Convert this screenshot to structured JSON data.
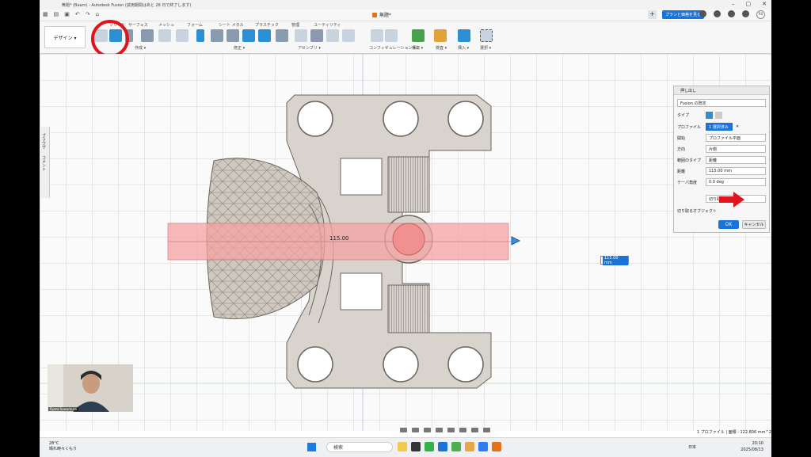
{
  "window": {
    "title": "無題* (Baam) - Autodesk Fusion (試用期間はあと 28 日で終了します)",
    "doc_tab": "無題*",
    "buy_button": "プランと価格を見る",
    "user_initials": "RS"
  },
  "toolbar": {
    "design_label": "デザイン ▾",
    "groups": {
      "solid": "ソリッド",
      "surface": "サーフェス",
      "mesh": "メッシュ",
      "form": "フォーム",
      "sheet_metal": "シート メタル",
      "plastic": "プラスチック",
      "manage": "管理",
      "utility": "ユーティリティ"
    },
    "bottom_labels": {
      "create": "作成 ▾",
      "modify": "修正 ▾",
      "assemble": "アセンブリ ▾",
      "configure": "コンフィギュレーション ▾",
      "construct": "構築 ▾",
      "inspect": "検査 ▾",
      "insert": "挿入 ▾",
      "select": "選択 ▾"
    }
  },
  "left_panel": {
    "browser": "ブラウザ",
    "comments": "コメント"
  },
  "viewcube": {
    "face": "右"
  },
  "dialog": {
    "title": "押し出し",
    "fusion_default": "Fusion の既定",
    "type_label": "タイプ",
    "profile_label": "プロファイル",
    "profile_value": "1 選択済み",
    "start_label": "開始",
    "start_value": "プロファイル平面",
    "direction_label": "方向",
    "direction_value": "片側",
    "extent_label": "範囲のタイプ",
    "extent_value": "距離",
    "distance_label": "距離",
    "distance_value": "115.00 mm",
    "taper_label": "テーパ角度",
    "taper_value": "0.0 deg",
    "operation_value": "切り取り",
    "objects_label": "切り取るオブジェクト",
    "ok": "OK",
    "cancel": "キャンセル"
  },
  "viewport": {
    "dimension_inline": "115.00",
    "distance_input": "115.00 mm",
    "status": "1 プロファイル | 面積 : 122.806 mm^2"
  },
  "webcam": {
    "name": "Ryota Sawamura"
  },
  "taskbar": {
    "temp": "28°C",
    "weather": "晴れ時々くもり",
    "search": "検索",
    "lang": "日本",
    "time": "20:10",
    "date": "2025/08/13"
  },
  "colors": {
    "accent": "#1a73d8",
    "highlight": "#e0141e",
    "cut_preview": "#f5a3a3"
  }
}
